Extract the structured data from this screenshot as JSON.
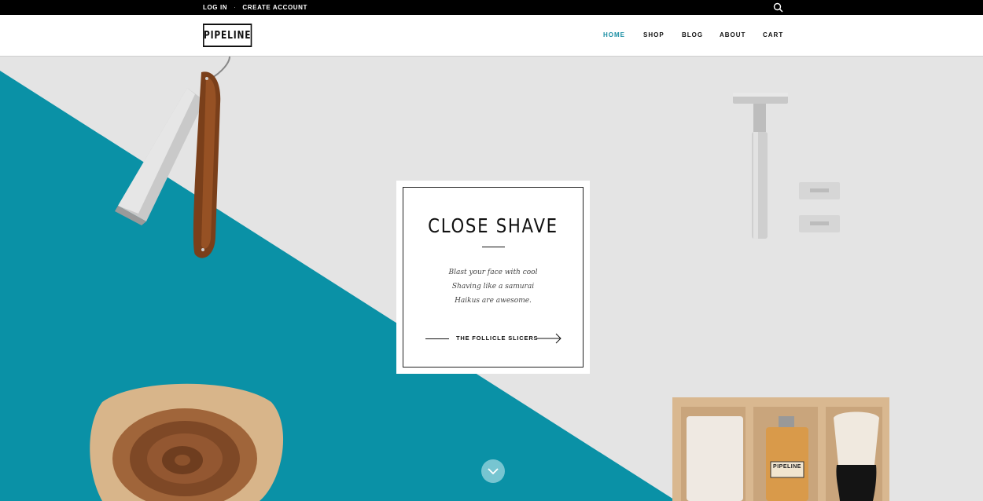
{
  "topbar": {
    "login": "LOG IN",
    "separator": "·",
    "create_account": "CREATE ACCOUNT",
    "search_icon": "search-icon"
  },
  "header": {
    "logo": "PIPELINE",
    "nav": [
      {
        "label": "HOME",
        "active": true
      },
      {
        "label": "SHOP",
        "active": false
      },
      {
        "label": "BLOG",
        "active": false
      },
      {
        "label": "ABOUT",
        "active": false
      },
      {
        "label": "CART",
        "active": false
      }
    ]
  },
  "hero": {
    "title": "CLOSE SHAVE",
    "poem": [
      "Blast your face with cool",
      "Shaving like a samurai",
      "Haikus are awesome."
    ],
    "cta_label": "THE FOLLICLE SLICERS",
    "box_label": "PIPELINE",
    "scroll_icon": "chevron-down-icon"
  },
  "colors": {
    "accent": "#1a8ea3",
    "teal": "#0a91a6",
    "background": "#e4e4e4"
  }
}
